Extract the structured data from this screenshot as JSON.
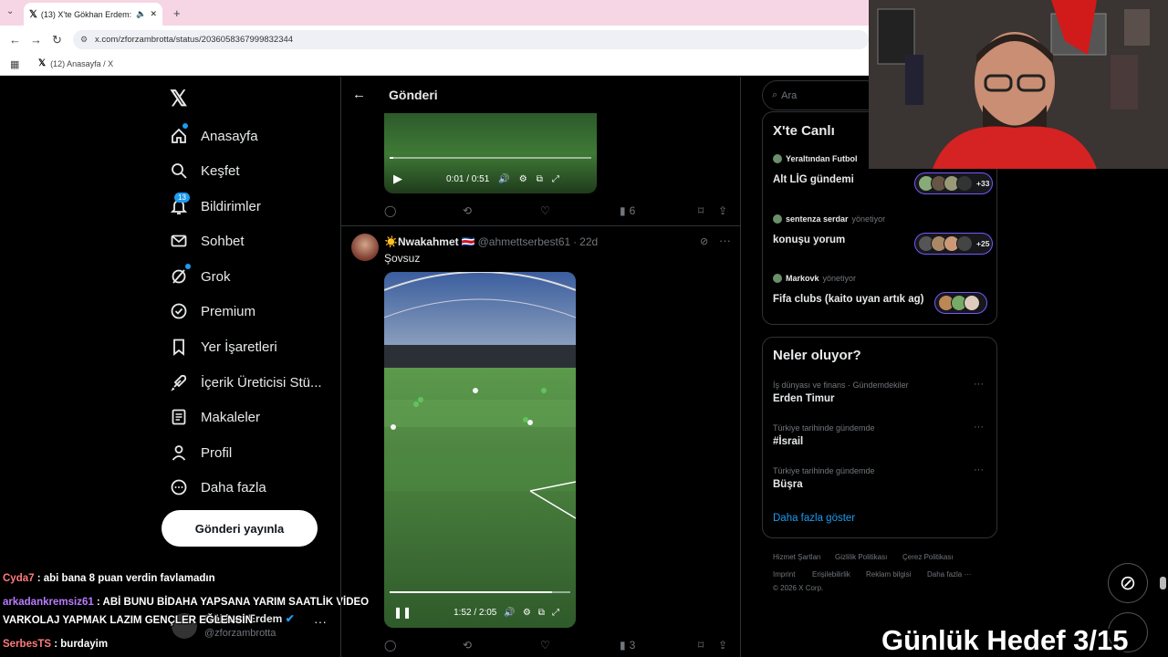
{
  "browser": {
    "tab_title": "(13) X'te Gökhan Erdem: \"M",
    "url": "x.com/zforzambrotta/status/2036058367999832344",
    "bookmark": "(12) Anasayfa / X"
  },
  "nav": {
    "items": [
      {
        "label": "Anasayfa",
        "icon": "home-icon"
      },
      {
        "label": "Keşfet",
        "icon": "search-icon"
      },
      {
        "label": "Bildirimler",
        "icon": "bell-icon"
      },
      {
        "label": "Sohbet",
        "icon": "mail-icon"
      },
      {
        "label": "Grok",
        "icon": "grok-icon"
      },
      {
        "label": "Premium",
        "icon": "verified-badge-icon"
      },
      {
        "label": "Yer İşaretleri",
        "icon": "bookmark-icon"
      },
      {
        "label": "İçerik Üreticisi Stü...",
        "icon": "rocket-icon"
      },
      {
        "label": "Makaleler",
        "icon": "article-icon"
      },
      {
        "label": "Profil",
        "icon": "person-icon"
      },
      {
        "label": "Daha fazla",
        "icon": "more-circle-icon"
      }
    ],
    "notif_count": "13",
    "post_button": "Gönderi yayınla",
    "account_name": "Gökhan Erdem",
    "account_handle": "@zforzambrotta"
  },
  "chat": [
    {
      "user": "Cyda7",
      "text": " : abi bana 8 puan verdin favlamadın"
    },
    {
      "user": "arkadankremsiz61",
      "text": " : ABİ BUNU BİDAHA YAPSANA YARIM SAATLİK VİDEO"
    },
    {
      "user": "",
      "text": "VARKOLAJ YAPMAK LAZIM GENÇLER EĞLENSİN"
    },
    {
      "user": "SerbesTS",
      "text": " : burdayim"
    }
  ],
  "post": {
    "header_title": "Gönderi",
    "video1": {
      "time": "0:01 / 0:51",
      "progress": 0.02
    },
    "actions1": {
      "views": "6"
    },
    "author_name": "☀️Nwakahmet",
    "author_flag": "🇨🇷",
    "author_handle": "@ahmettserbest61",
    "age": "22d",
    "text": "Şovsuz",
    "video2": {
      "time": "1:52 / 2:05",
      "progress": 0.9
    },
    "actions2": {
      "views": "3"
    }
  },
  "right": {
    "search_placeholder": "Ara",
    "live_title": "X'te Canlı",
    "spaces": [
      {
        "host": "Yeraltından Futbol",
        "role": "",
        "title": "Alt LİG gündemi",
        "count": "+33"
      },
      {
        "host": "sentenza serdar",
        "role": "yönetiyor",
        "title": "konuşu yorum",
        "count": "+25"
      },
      {
        "host": "Markovk",
        "role": "yönetiyor",
        "title": "Fifa clubs (kaito uyan artık ag)",
        "count": ""
      }
    ],
    "trends_title": "Neler oluyor?",
    "trends": [
      {
        "category": "İş dünyası ve finans · Gündemdekiler",
        "name": "Erden Timur"
      },
      {
        "category": "Türkiye tarihinde gündemde",
        "name": "#İsrail"
      },
      {
        "category": "Türkiye tarihinde gündemde",
        "name": "Büşra"
      }
    ],
    "show_more": "Daha fazla göster",
    "footer_row1": [
      "Hizmet Şartları",
      "Gizlilik Politikası",
      "Çerez Politikası"
    ],
    "footer_row2": [
      "Imprint",
      "Erişilebilirlik",
      "Reklam bilgisi",
      "Daha fazla ···"
    ],
    "copyright": "© 2026 X Corp."
  },
  "overlay": {
    "goal": "Günlük Hedef 3/15"
  }
}
